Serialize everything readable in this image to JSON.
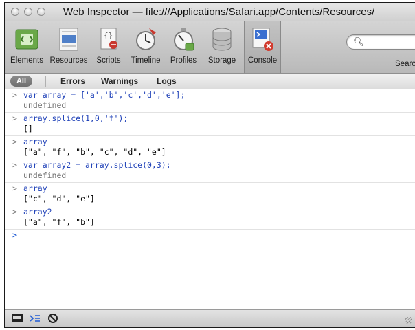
{
  "window": {
    "title": "Web Inspector — file:///Applications/Safari.app/Contents/Resources/"
  },
  "toolbar": {
    "items": [
      {
        "label": "Elements",
        "icon": "elements-icon"
      },
      {
        "label": "Resources",
        "icon": "resources-icon"
      },
      {
        "label": "Scripts",
        "icon": "scripts-icon"
      },
      {
        "label": "Timeline",
        "icon": "timeline-icon"
      },
      {
        "label": "Profiles",
        "icon": "profiles-icon"
      },
      {
        "label": "Storage",
        "icon": "storage-icon"
      },
      {
        "label": "Console",
        "icon": "console-icon",
        "active": true
      }
    ],
    "search_label": "Search",
    "search_visible_label": "Searc"
  },
  "filters": {
    "all": "All",
    "errors": "Errors",
    "warnings": "Warnings",
    "logs": "Logs"
  },
  "console": {
    "entries": [
      {
        "command": "var array = ['a','b','c','d','e'];",
        "result": "undefined"
      },
      {
        "command": "array.splice(1,0,'f');",
        "result": "[]"
      },
      {
        "command": "array",
        "result": "[\"a\", \"f\", \"b\", \"c\", \"d\", \"e\"]"
      },
      {
        "command": "var array2 = array.splice(0,3);",
        "result": "undefined"
      },
      {
        "command": "array",
        "result": "[\"c\", \"d\", \"e\"]"
      },
      {
        "command": "array2",
        "result": "[\"a\", \"f\", \"b\"]"
      }
    ],
    "prompt_symbol": ">"
  },
  "colors": {
    "command_text": "#1f41b8",
    "undefined_text": "#747474",
    "prompt_caret": "#2a63d6"
  }
}
